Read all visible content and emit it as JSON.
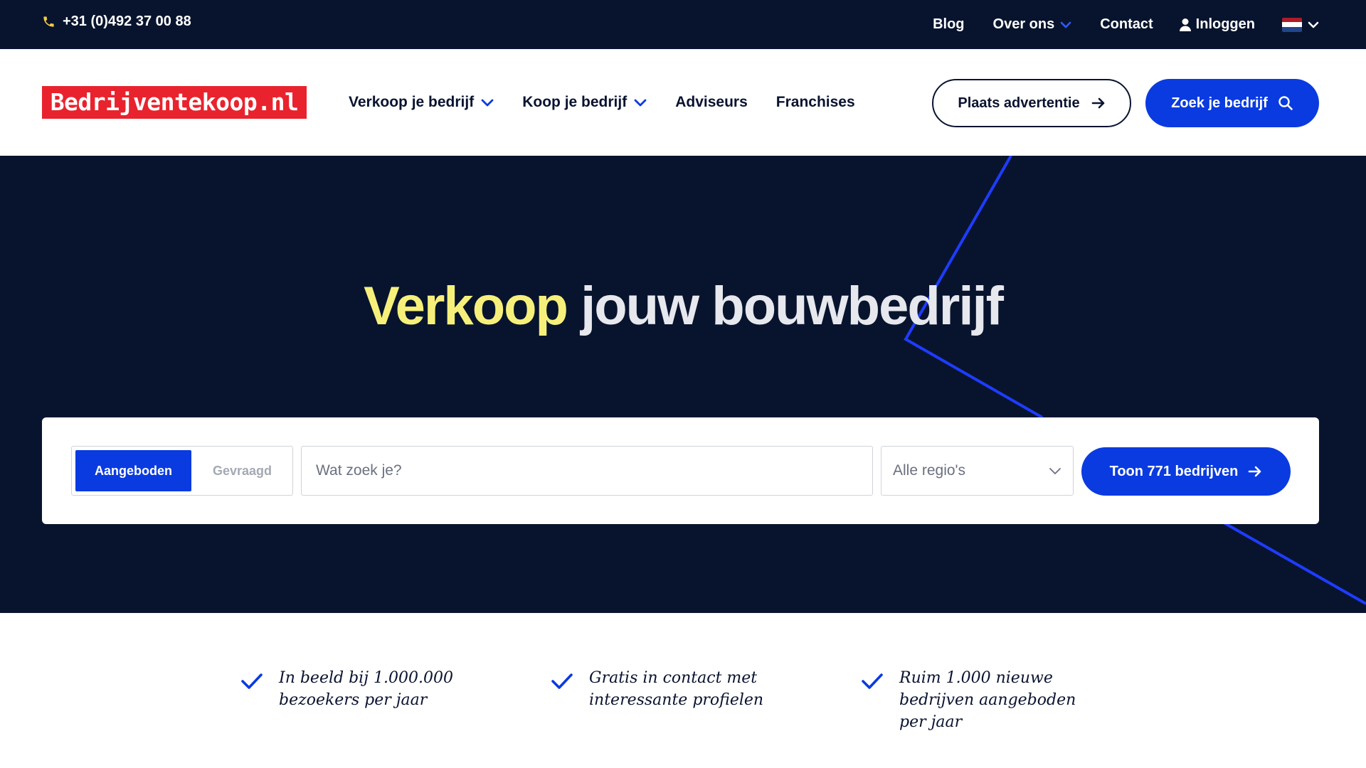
{
  "topbar": {
    "phone": "+31 (0)492 37 00 88",
    "nav": {
      "blog": "Blog",
      "about": "Over ons",
      "contact": "Contact",
      "login": "Inloggen"
    }
  },
  "header": {
    "logo_text": "Bedrijventekoop.nl",
    "nav": {
      "sell": "Verkoop je bedrijf",
      "buy": "Koop je bedrijf",
      "advisors": "Adviseurs",
      "franchises": "Franchises"
    },
    "place_ad": "Plaats advertentie",
    "find_business": "Zoek je bedrijf"
  },
  "hero": {
    "title_highlight": "Verkoop",
    "title_rest": "jouw bouwbedrijf",
    "search": {
      "tab_offered": "Aangeboden",
      "tab_wanted": "Gevraagd",
      "placeholder": "Wat zoek je?",
      "region": "Alle regio's",
      "submit": "Toon 771 bedrijven"
    }
  },
  "usps": [
    "In beeld bij 1.000.000 bezoekers per jaar",
    "Gratis in contact met interessante profielen",
    "Ruim 1.000 nieuwe bedrijven aangeboden per jaar"
  ],
  "colors": {
    "navy": "#08142e",
    "brand_blue": "#0a3be0",
    "logo_red": "#e8232d",
    "highlight_yellow": "#f6f07a",
    "phone_icon": "#f6c945"
  },
  "icons": {
    "phone": "phone-icon",
    "chevron": "chevron-down-icon",
    "user": "user-icon",
    "flag": "flag-nl-icon",
    "arrow": "arrow-right-icon",
    "search": "search-icon",
    "check": "check-icon"
  }
}
